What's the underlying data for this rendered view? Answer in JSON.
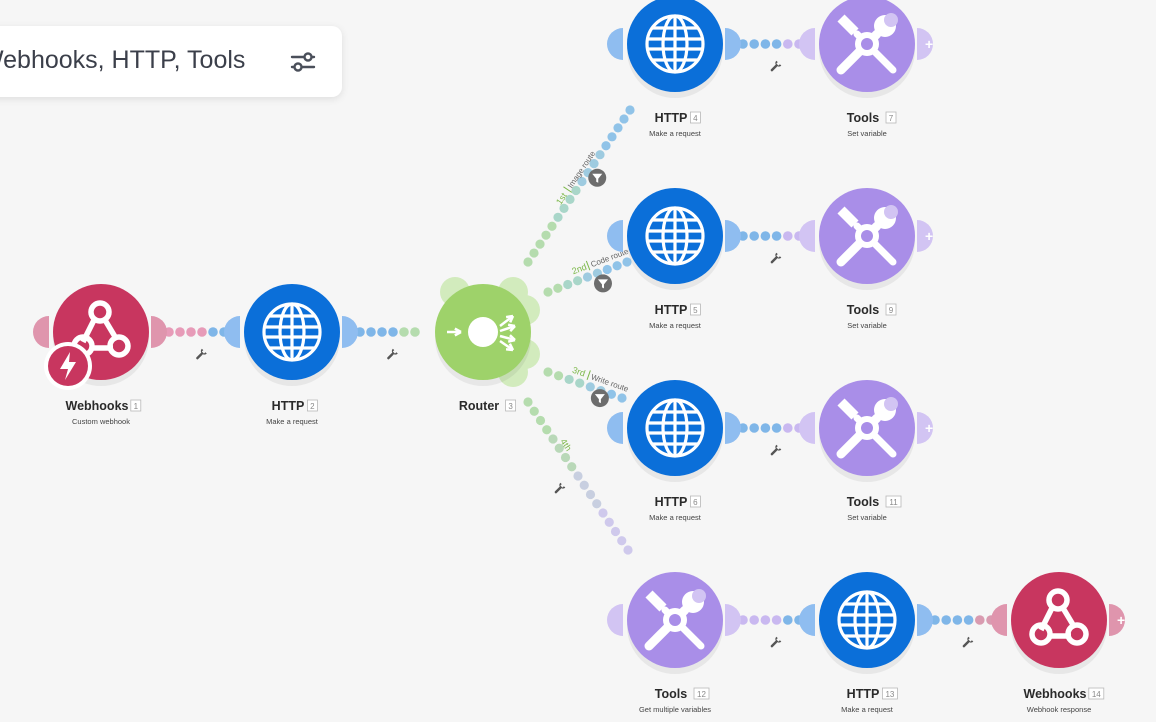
{
  "search": {
    "text": "Webhooks, HTTP, Tools",
    "filter_icon": "sliders-icon"
  },
  "colors": {
    "webhooks": "#c8365f",
    "http": "#0b6fd9",
    "router": "#9ed26a",
    "tools": "#a98ee8",
    "background": "#f6f6f6"
  },
  "modules": [
    {
      "id": "1",
      "app": "Webhooks",
      "num": "1",
      "sub": "Custom webhook",
      "type": "webhooks",
      "trigger": true
    },
    {
      "id": "2",
      "app": "HTTP",
      "num": "2",
      "sub": "Make a request",
      "type": "http"
    },
    {
      "id": "3",
      "app": "Router",
      "num": "3",
      "sub": "",
      "type": "router"
    },
    {
      "id": "4",
      "app": "HTTP",
      "num": "4",
      "sub": "Make a request",
      "type": "http"
    },
    {
      "id": "7",
      "app": "Tools",
      "num": "7",
      "sub": "Set variable",
      "type": "tools",
      "plus": true
    },
    {
      "id": "5",
      "app": "HTTP",
      "num": "5",
      "sub": "Make a request",
      "type": "http"
    },
    {
      "id": "9",
      "app": "Tools",
      "num": "9",
      "sub": "Set variable",
      "type": "tools",
      "plus": true
    },
    {
      "id": "6",
      "app": "HTTP",
      "num": "6",
      "sub": "Make a request",
      "type": "http"
    },
    {
      "id": "11",
      "app": "Tools",
      "num": "11",
      "sub": "Set variable",
      "type": "tools",
      "plus": true
    },
    {
      "id": "12",
      "app": "Tools",
      "num": "12",
      "sub": "Get multiple variables",
      "type": "tools"
    },
    {
      "id": "13",
      "app": "HTTP",
      "num": "13",
      "sub": "Make a request",
      "type": "http"
    },
    {
      "id": "14",
      "app": "Webhooks",
      "num": "14",
      "sub": "Webhook response",
      "type": "webhooks",
      "plus": true
    }
  ],
  "routes": [
    {
      "order": "1st",
      "name": "Image route",
      "filter": true
    },
    {
      "order": "2nd",
      "name": "Code route",
      "filter": true
    },
    {
      "order": "3rd",
      "name": "Write route",
      "filter": true
    },
    {
      "order": "4th",
      "name": "",
      "filter": false
    }
  ]
}
